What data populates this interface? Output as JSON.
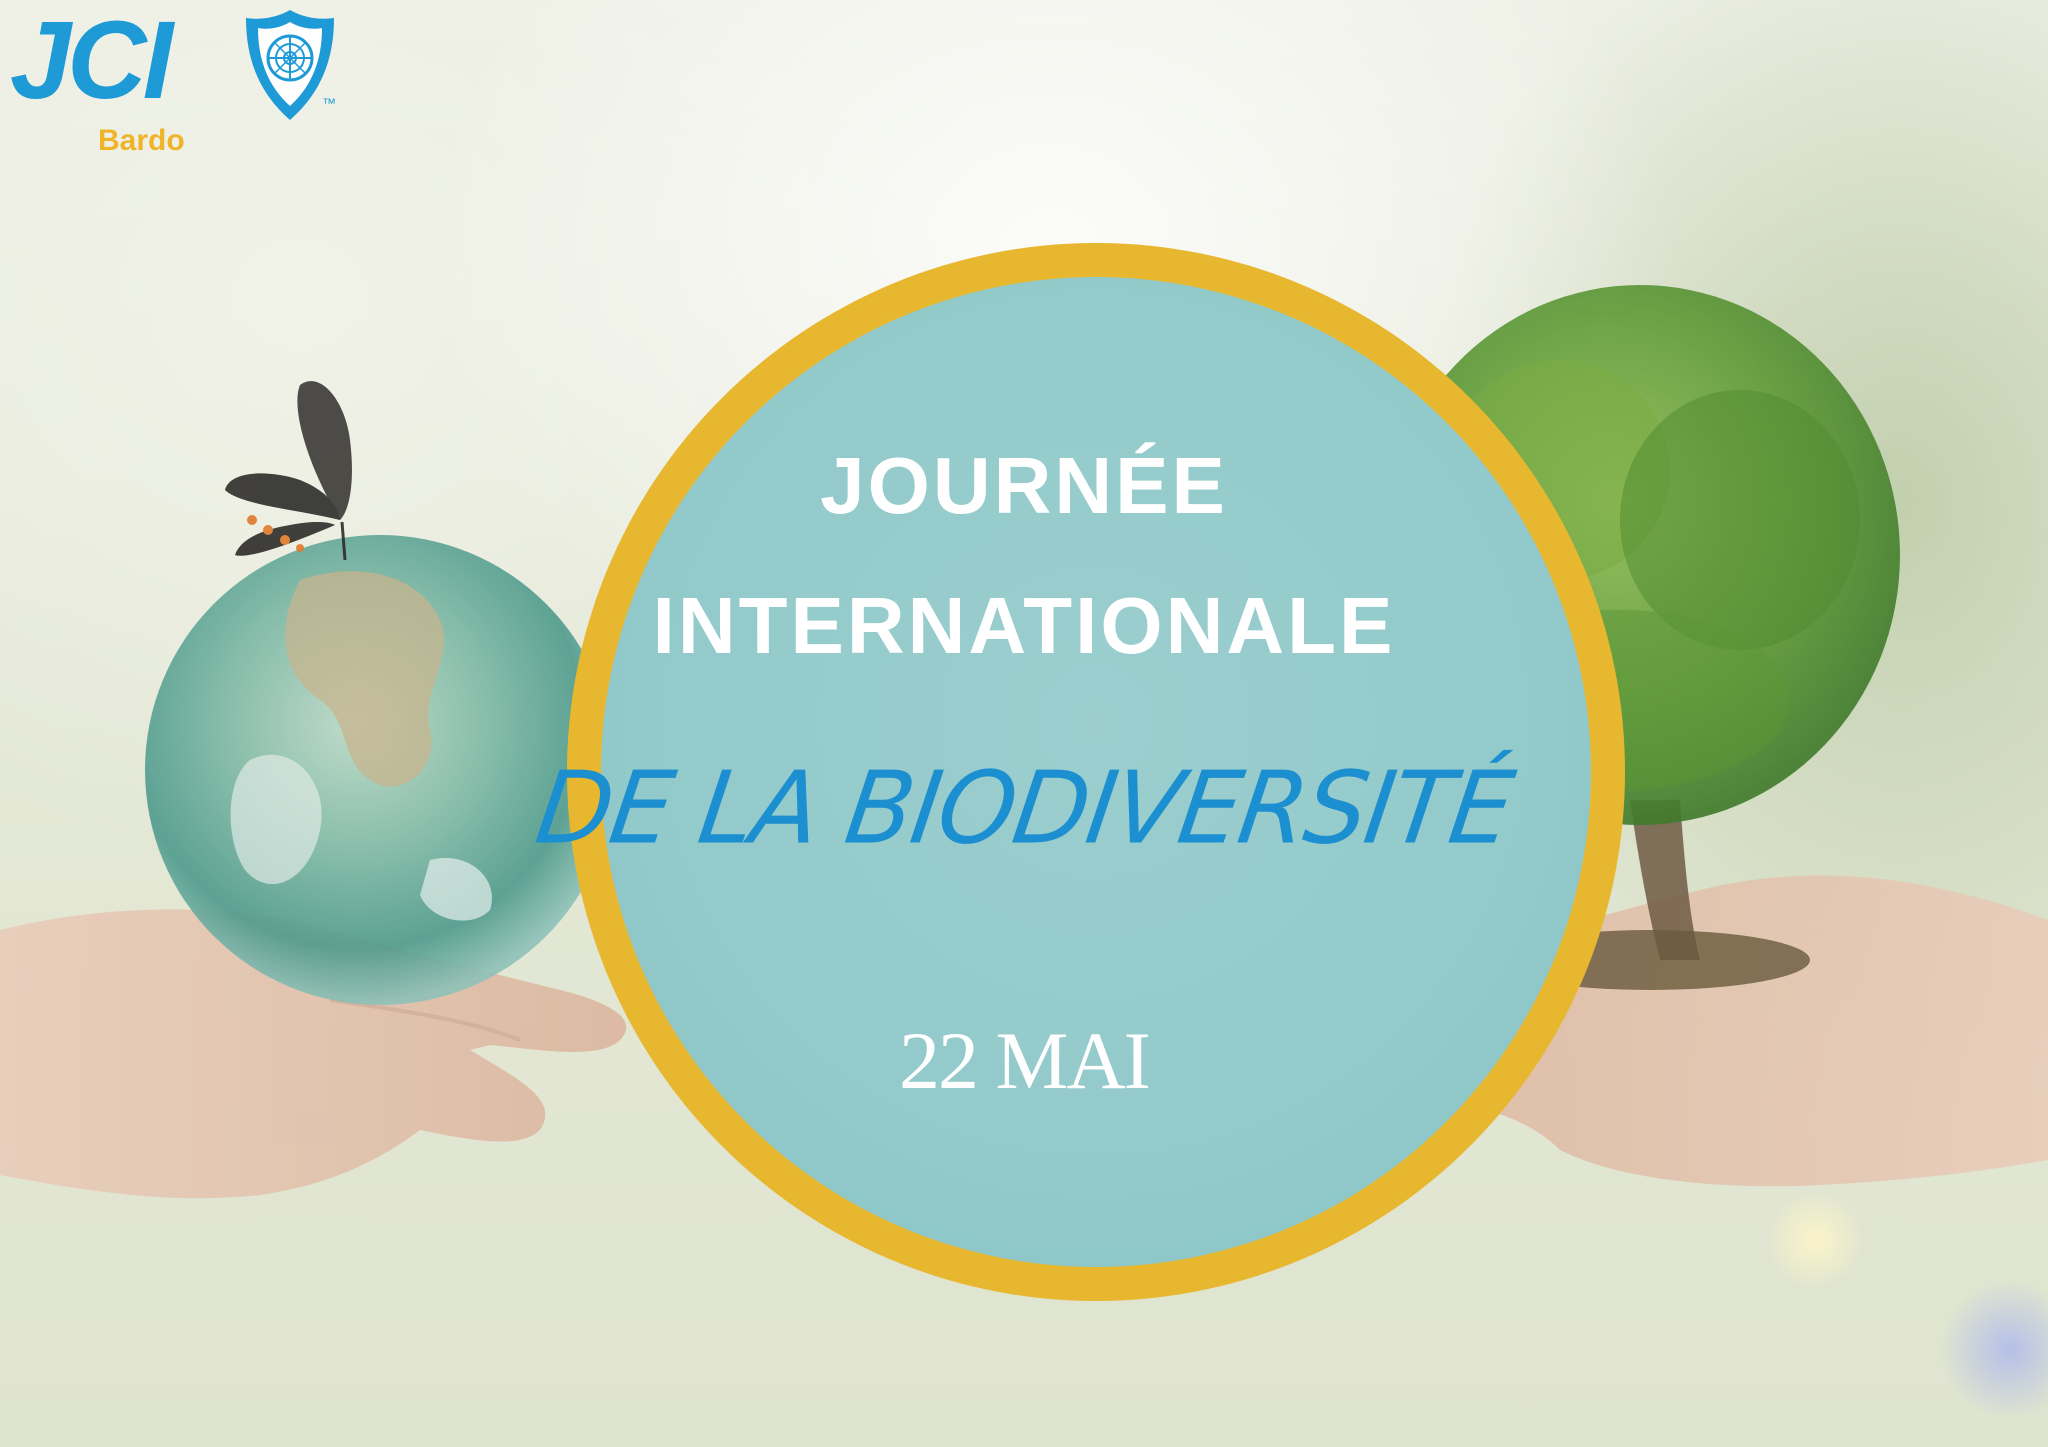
{
  "logo": {
    "name": "JCI",
    "chapter": "Bardo",
    "trademark": "™",
    "shield_icon": "jci-shield-globe-icon"
  },
  "headline": {
    "line1": "JOURNÉE",
    "line2": "INTERNATIONALE",
    "subtitle": "DE LA BIODIVERSITÉ",
    "date": "22 MAI"
  },
  "colors": {
    "brand_blue": "#1e9ad6",
    "brand_gold": "#f0b429",
    "ring_gold": "#e8b730",
    "disc_teal": "#8ecbd6",
    "title_white": "#ffffff",
    "subtitle_blue": "#1c8fd0"
  },
  "illustration": {
    "left": "hands-holding-globe-with-butterfly",
    "right": "hands-holding-tree"
  }
}
